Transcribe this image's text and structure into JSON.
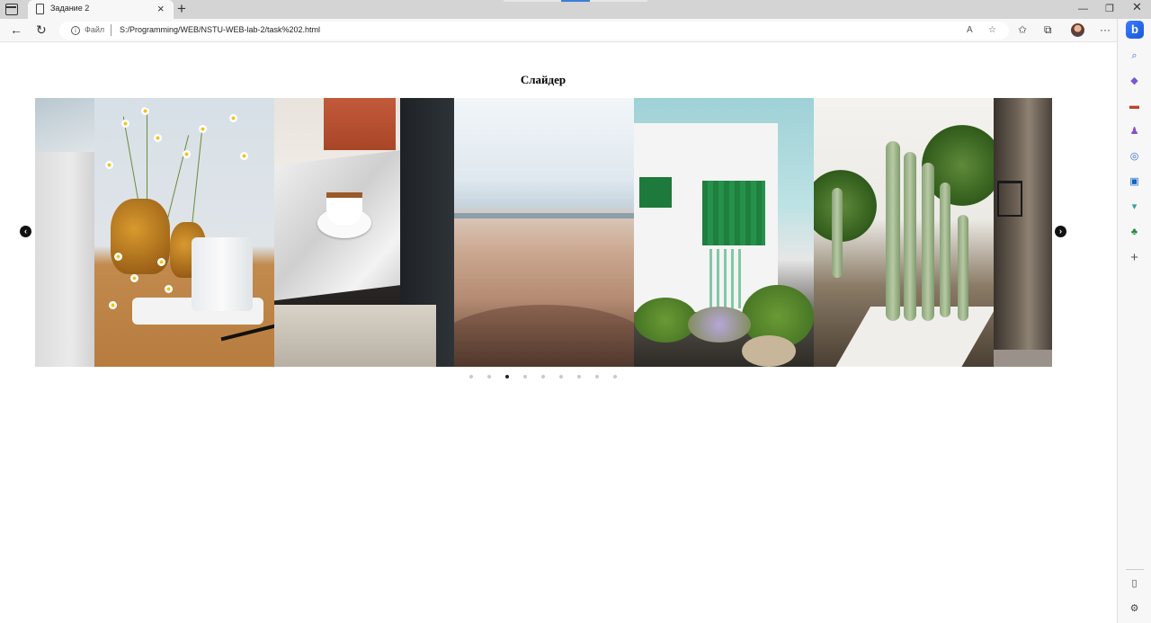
{
  "browser": {
    "tab_title": "Задание 2",
    "address_prefix": "Файл",
    "url": "S:/Programming/WEB/NSTU-WEB-lab-2/task%202.html"
  },
  "page": {
    "title": "Слайдер"
  },
  "slider": {
    "slides": [
      {
        "name": "white-wall"
      },
      {
        "name": "chamomile-vase"
      },
      {
        "name": "coffee-cup-marble-table"
      },
      {
        "name": "desert-dunes"
      },
      {
        "name": "white-house-green-door"
      },
      {
        "name": "cactus-garden"
      },
      {
        "name": "old-town-street"
      }
    ],
    "dot_count": 9,
    "active_dot_index": 2
  },
  "icons": {
    "back": "arrow-left-icon",
    "reload": "reload-icon",
    "read_aloud": "read-aloud-icon",
    "favorite": "star-icon",
    "collections": "collections-icon",
    "extensions": "extensions-icon",
    "more": "more-icon",
    "bing": "bing-icon"
  },
  "colors": {
    "active_dot": "#222222",
    "inactive_dot": "#c9c9c9",
    "bing_accent": "#1a5ad7"
  }
}
